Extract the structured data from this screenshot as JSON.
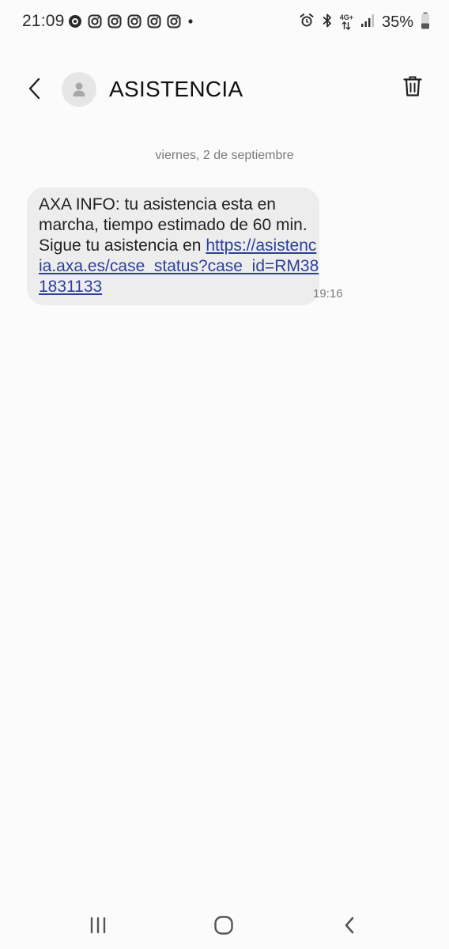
{
  "status_bar": {
    "time": "21:09",
    "network_label_top": "4G+",
    "battery_percent": "35%",
    "notification_icons": [
      "podcast-icon",
      "instagram-icon",
      "instagram-icon",
      "instagram-icon",
      "instagram-icon",
      "instagram-icon",
      "more-dot-icon"
    ],
    "system_icons": [
      "alarm-icon",
      "bluetooth-icon",
      "network-4g-icon",
      "signal-icon",
      "battery-icon"
    ]
  },
  "header": {
    "contact_name": "ASISTENCIA"
  },
  "conversation": {
    "date_separator": "viernes, 2 de septiembre",
    "messages": [
      {
        "text_before_link": "AXA INFO: tu asistencia esta en marcha, tiempo estimado de 60 min. Sigue tu asistencia en ",
        "link": "https://asistencia.axa.es/case_status?case_id=RM381831133",
        "time": "19:16"
      }
    ]
  },
  "nav_bar": {
    "buttons": [
      "recent-apps",
      "home",
      "back"
    ]
  },
  "colors": {
    "background": "#fbfbfb",
    "bubble": "#ededed",
    "link": "#2b3f9c",
    "secondary_text": "#7a7a7a"
  }
}
